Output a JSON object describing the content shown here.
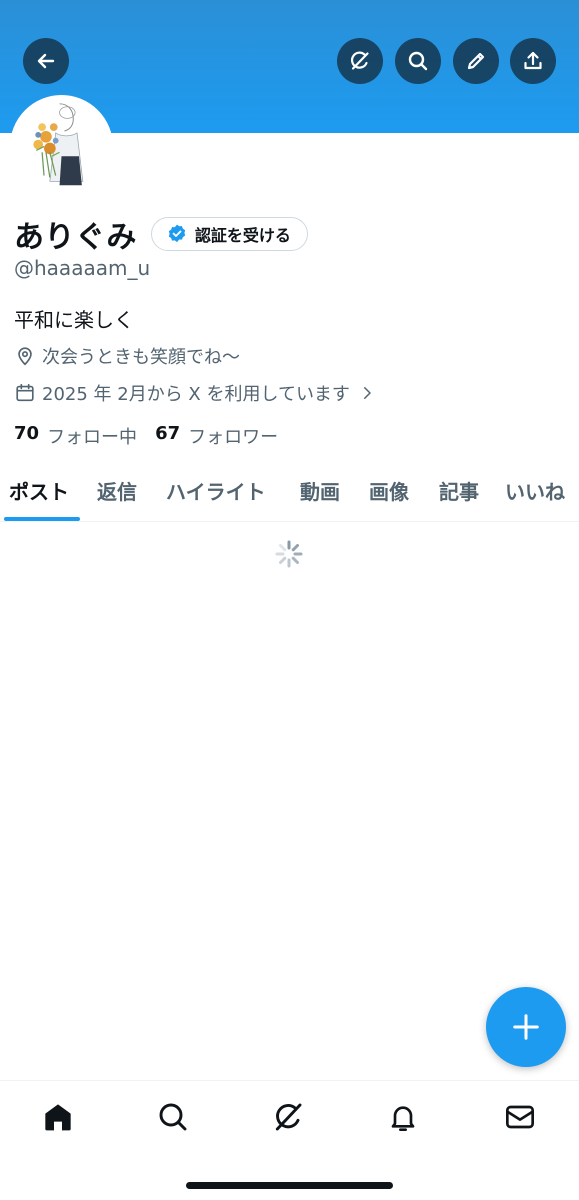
{
  "header": {
    "buttons": [
      {
        "name": "back",
        "icon": "arrow-left-icon"
      },
      {
        "name": "grok",
        "icon": "grok-icon"
      },
      {
        "name": "search",
        "icon": "search-icon"
      },
      {
        "name": "edit",
        "icon": "pencil-icon"
      },
      {
        "name": "share",
        "icon": "share-upload-icon"
      }
    ],
    "banner_color": "#1d9bf0"
  },
  "profile": {
    "display_name": "ありぐみ",
    "verify_label": "認証を受ける",
    "handle": "@haaaaam_u",
    "bio": "平和に楽しく",
    "location": "次会うときも笑顔でね〜",
    "joined": "2025 年 2月から X を利用しています",
    "following_count": "70",
    "following_label": "フォロー中",
    "followers_count": "67",
    "followers_label": "フォロワー"
  },
  "tabs": [
    {
      "label": "ポスト",
      "active": true
    },
    {
      "label": "返信",
      "active": false
    },
    {
      "label": "ハイライト",
      "active": false
    },
    {
      "label": "動画",
      "active": false
    },
    {
      "label": "画像",
      "active": false
    },
    {
      "label": "記事",
      "active": false
    },
    {
      "label": "いいね",
      "active": false
    }
  ],
  "fab": {
    "icon": "plus-icon"
  },
  "bottom_nav": [
    {
      "name": "home",
      "icon": "home-icon",
      "active": true
    },
    {
      "name": "search",
      "icon": "search-icon"
    },
    {
      "name": "grok",
      "icon": "grok-icon"
    },
    {
      "name": "notifications",
      "icon": "bell-icon"
    },
    {
      "name": "messages",
      "icon": "mail-icon"
    }
  ],
  "colors": {
    "accent": "#1d9bf0",
    "text_primary": "#0f1419",
    "text_secondary": "#536471"
  }
}
